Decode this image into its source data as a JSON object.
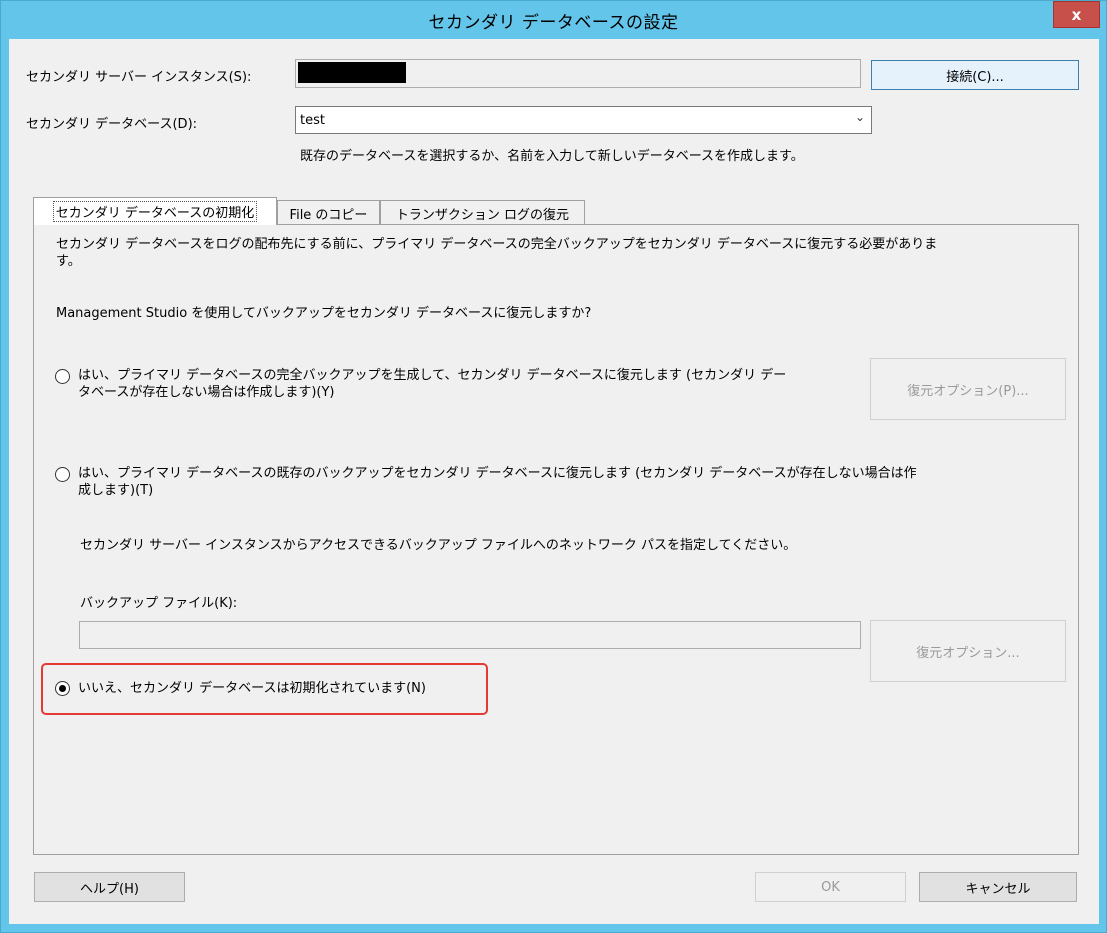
{
  "window": {
    "title": "セカンダリ データベースの設定",
    "close_label": "x"
  },
  "server": {
    "label": "セカンダリ サーバー インスタンス(S):",
    "connect_label": "接続(C)..."
  },
  "database": {
    "label": "セカンダリ データベース(D):",
    "value": "test",
    "hint": "既存のデータベースを選択するか、名前を入力して新しいデータベースを作成します。"
  },
  "tabs": [
    {
      "label": "セカンダリ データベースの初期化"
    },
    {
      "label": "File のコピー"
    },
    {
      "label": "トランザクション ログの復元"
    }
  ],
  "init_tab": {
    "intro": "セカンダリ データベースをログの配布先にする前に、プライマリ データベースの完全バックアップをセカンダリ データベースに復元する必要がありま\nす。",
    "question": "Management Studio を使用してバックアップをセカンダリ データベースに復元しますか?",
    "option_full": "はい、プライマリ データベースの完全バックアップを生成して、セカンダリ データベースに復元します (セカンダリ デー\nタベースが存在しない場合は作成します)(Y)",
    "restore_options_p": "復元オプション(P)...",
    "option_existing": "はい、プライマリ データベースの既存のバックアップをセカンダリ データベースに復元します (セカンダリ データベースが存在しない場合は作\n成します)(T)",
    "network_path_hint": "セカンダリ サーバー インスタンスからアクセスできるバックアップ ファイルへのネットワーク パスを指定してください。",
    "backup_file_label": "バックアップ ファイル(K):",
    "backup_file_value": "",
    "restore_options": "復元オプション...",
    "option_none": "いいえ、セカンダリ データベースは初期化されています(N)",
    "selected_option": "option_none"
  },
  "footer": {
    "help": "ヘルプ(H)",
    "ok": "OK",
    "cancel": "キャンセル"
  },
  "colors": {
    "titlebar": "#62c5e9",
    "close": "#c7504a",
    "highlight": "#e53935",
    "dialog_bg": "#f0f0f0"
  }
}
